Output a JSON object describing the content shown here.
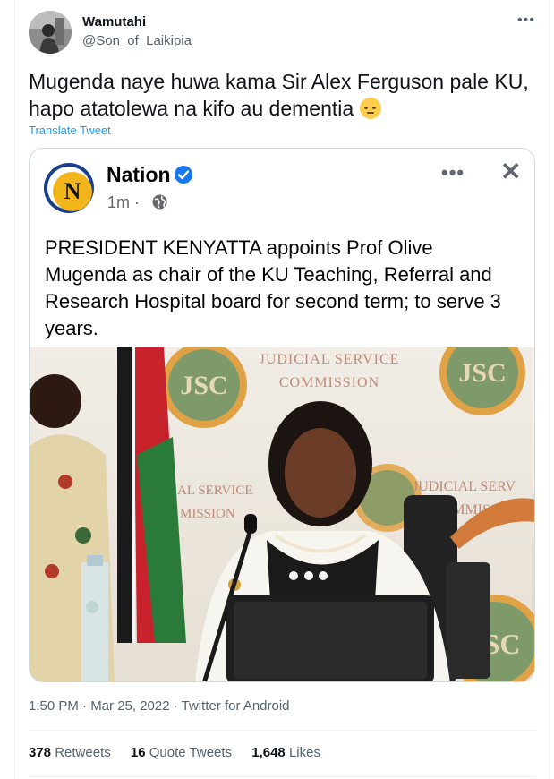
{
  "tweet": {
    "author_name": "Wamutahi",
    "author_handle": "@Son_of_Laikipia",
    "more_icon": "•••",
    "text_line1": "Mugenda naye huwa kama  Sir Alex Ferguson pale KU,",
    "text_line2": "hapo atatolewa na kifo au dementia",
    "emoji": "pensive-face",
    "translate_label": "Translate Tweet",
    "timestamp": "1:50 PM · Mar 25, 2022 · Twitter for Android",
    "stats": {
      "retweets_count": "378",
      "retweets_label": "Retweets",
      "quotes_count": "16",
      "quotes_label": "Quote Tweets",
      "likes_count": "1,648",
      "likes_label": "Likes"
    }
  },
  "embedded_post": {
    "logo_letter": "N",
    "page_name": "Nation",
    "time": "1m ·",
    "dots": "•••",
    "close": "✕",
    "body_lines": [
      "PRESIDENT KENYATTA appoints Prof Olive",
      "Mugenda as chair of the KU Teaching, Referral and",
      "Research Hospital board for second term; to serve 3",
      "years."
    ],
    "photo_text": {
      "backdrop_top_1": "JUDICIAL SERVICE",
      "backdrop_top_2": "COMMISSION",
      "backdrop_left_1": "AL SERVICE",
      "backdrop_left_2": "MISSION",
      "backdrop_right_1": "JUDICIAL SERV",
      "backdrop_right_2": "COMMISSI",
      "seal_text": "JSC"
    }
  },
  "colors": {
    "accent": "#1d9bf0",
    "verified": "#1877f2",
    "nation_yellow": "#f2b51c",
    "nation_blue": "#1a3f8f",
    "jsc_green": "#6b8e5a",
    "jsc_gold": "#e0a245"
  }
}
